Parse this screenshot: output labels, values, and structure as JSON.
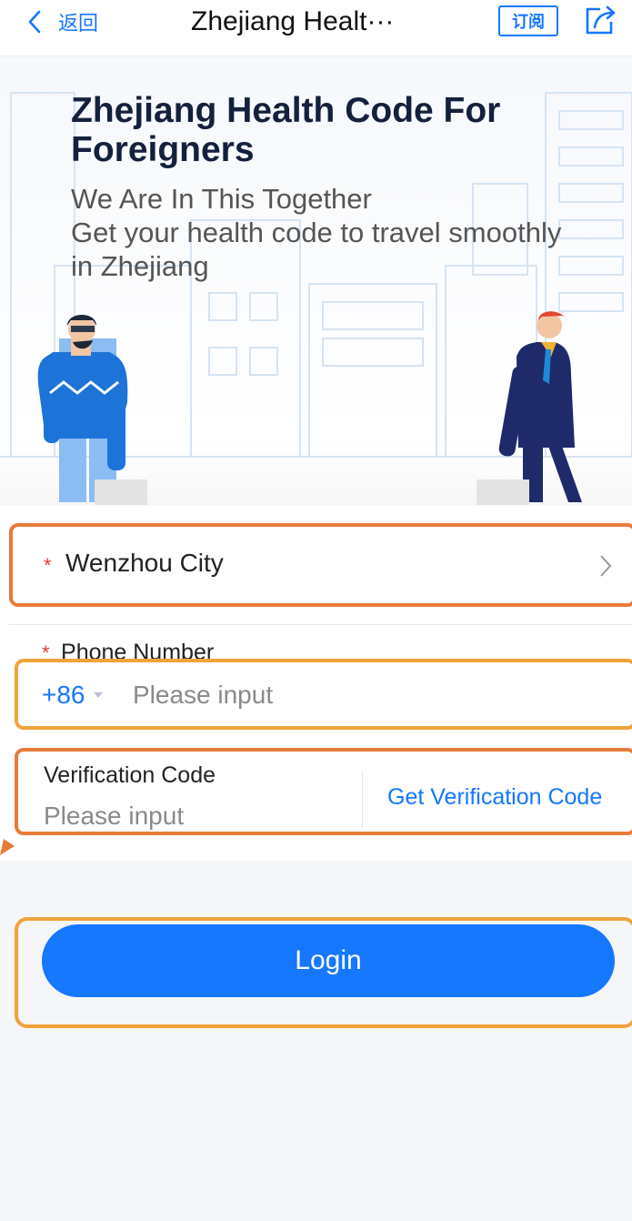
{
  "navbar": {
    "back_label": "返回",
    "title": "Zhejiang Healt···",
    "subscribe_label": "订阅",
    "icons": {
      "back": "chevron-left-icon",
      "share": "share-icon"
    }
  },
  "hero": {
    "title": "Zhejiang Health Code For Foreigners",
    "subtitle_line1": "We Are In This Together",
    "subtitle_line2": "Get your health code to travel smoothly in Zhejiang"
  },
  "form": {
    "required_mark": "*",
    "city": {
      "value": "Wenzhou City"
    },
    "phone": {
      "label": "Phone Number",
      "country_code": "+86",
      "placeholder": "Please input",
      "value": ""
    },
    "verification": {
      "label": "Verification Code",
      "placeholder": "Please input",
      "value": "",
      "get_code_label": "Get Verification Code"
    }
  },
  "login": {
    "label": "Login"
  },
  "colors": {
    "accent": "#1677ff",
    "required": "#e33b3b",
    "highlight_orange": "#e87b3a",
    "highlight_yellow": "#f0a33b"
  }
}
